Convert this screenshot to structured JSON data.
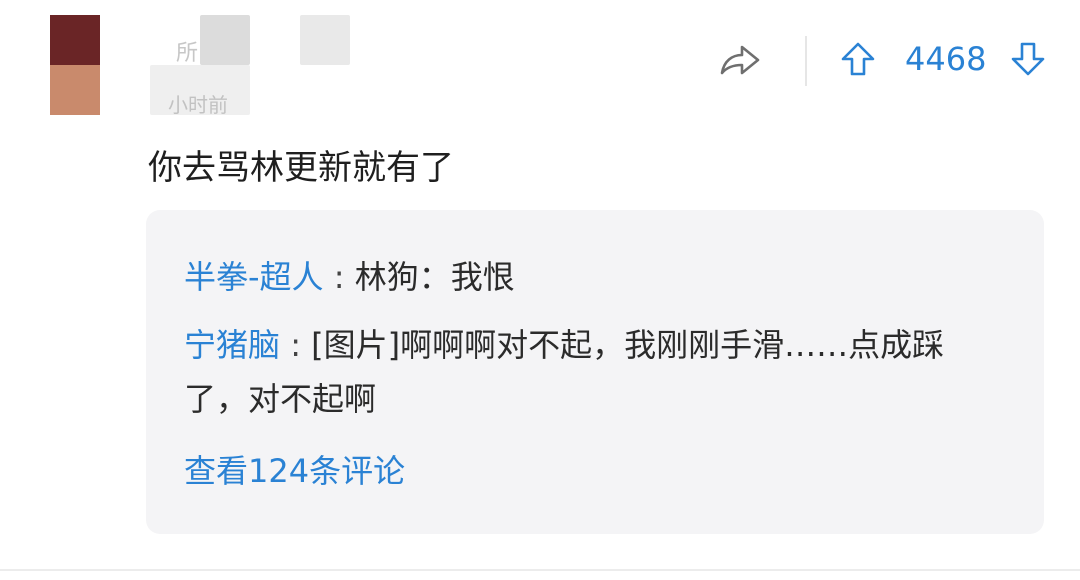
{
  "comment": {
    "username": "所",
    "time": "小时前",
    "text": "你去骂林更新就有了",
    "vote_count": "4468"
  },
  "replies": [
    {
      "name": "半拳-超人",
      "separator": " : ",
      "text": "林狗：我恨"
    },
    {
      "name": "宁猪脑",
      "separator": " : ",
      "text": "[图片]啊啊啊对不起，我刚刚手滑……点成踩了，对不起啊"
    }
  ],
  "view_all_label": "查看124条评论",
  "icons": {
    "share": "share-icon",
    "upvote": "arrow-up-icon",
    "downvote": "arrow-down-icon"
  },
  "colors": {
    "accent": "#2a82d4",
    "reply_background": "#f4f4f6",
    "text": "#1f1f1f"
  }
}
